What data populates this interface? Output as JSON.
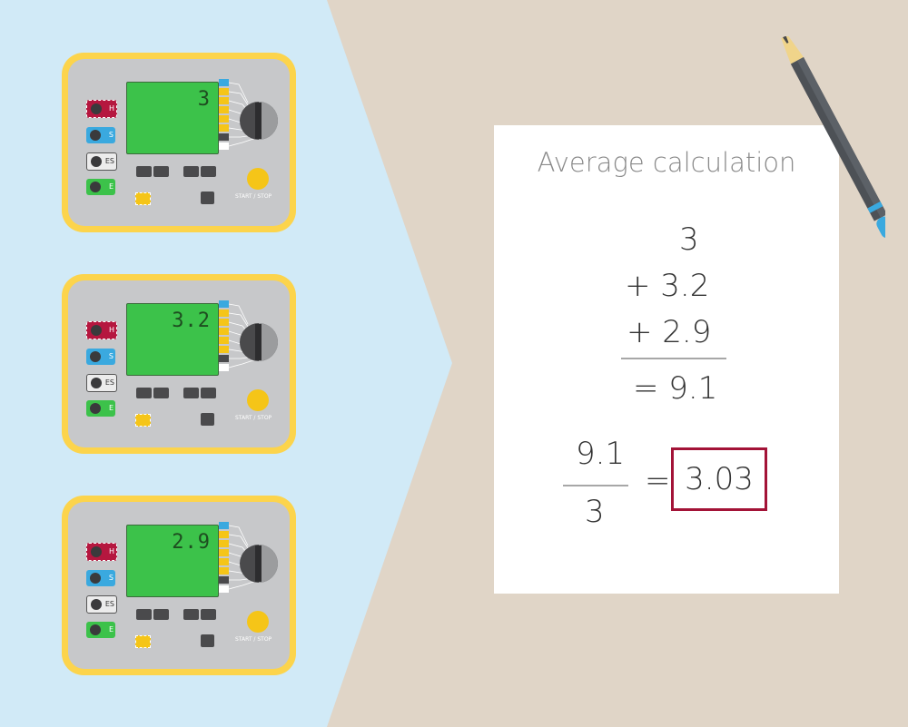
{
  "colors": {
    "left_panel": "#d1eaf7",
    "background": "#e0d5c7",
    "meter_frame": "#fcd44c",
    "meter_face": "#c7c8ca",
    "screen": "#3cc24a",
    "result_border": "#a31337"
  },
  "meters": [
    {
      "reading": "3",
      "buttons": [
        "H",
        "S",
        "ES",
        "E"
      ],
      "start_label": "START / STOP"
    },
    {
      "reading": "3.2",
      "buttons": [
        "H",
        "S",
        "ES",
        "E"
      ],
      "start_label": "START / STOP"
    },
    {
      "reading": "2.9",
      "buttons": [
        "H",
        "S",
        "ES",
        "E"
      ],
      "start_label": "START / STOP"
    }
  ],
  "worksheet": {
    "title": "Average calculation",
    "addends": [
      "3",
      "+ 3.2",
      "+ 2.9"
    ],
    "sum": "= 9.1",
    "fraction_numerator": "9.1",
    "fraction_denominator": "3",
    "equals": "=",
    "result": "3.03"
  },
  "icons": [
    "pencil-icon",
    "arrow-pointer-icon",
    "dial-icon"
  ]
}
